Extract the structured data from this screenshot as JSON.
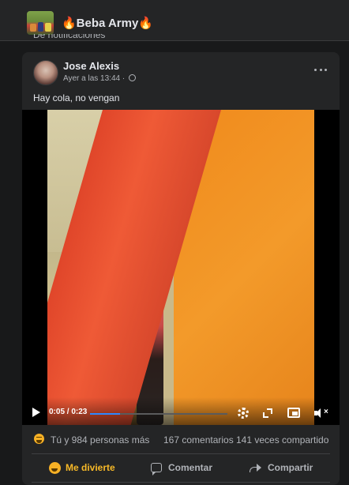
{
  "group": {
    "name": "🔥Beba Army🔥",
    "peek_text": "De notificaciones"
  },
  "post": {
    "author": "Jose Alexis",
    "time": "Ayer a las 13:44",
    "dot": "·",
    "text": "Hay cola, no vengan"
  },
  "video": {
    "time_display": "0:05 / 0:23",
    "progress_fraction": 0.217,
    "icons": [
      "play-icon",
      "gear-icon",
      "expand-icon",
      "pip-icon",
      "volume-icon"
    ]
  },
  "stats": {
    "reactions": "Tú y 984 personas más",
    "comments": "167 comentarios",
    "shares": "141 veces compartido"
  },
  "actions": {
    "react_label": "Me divierte",
    "comment_label": "Comentar",
    "share_label": "Compartir"
  },
  "colors": {
    "background": "#18191a",
    "card": "#242526",
    "reaction_active": "#f7b928",
    "progress": "#2d88ff"
  }
}
